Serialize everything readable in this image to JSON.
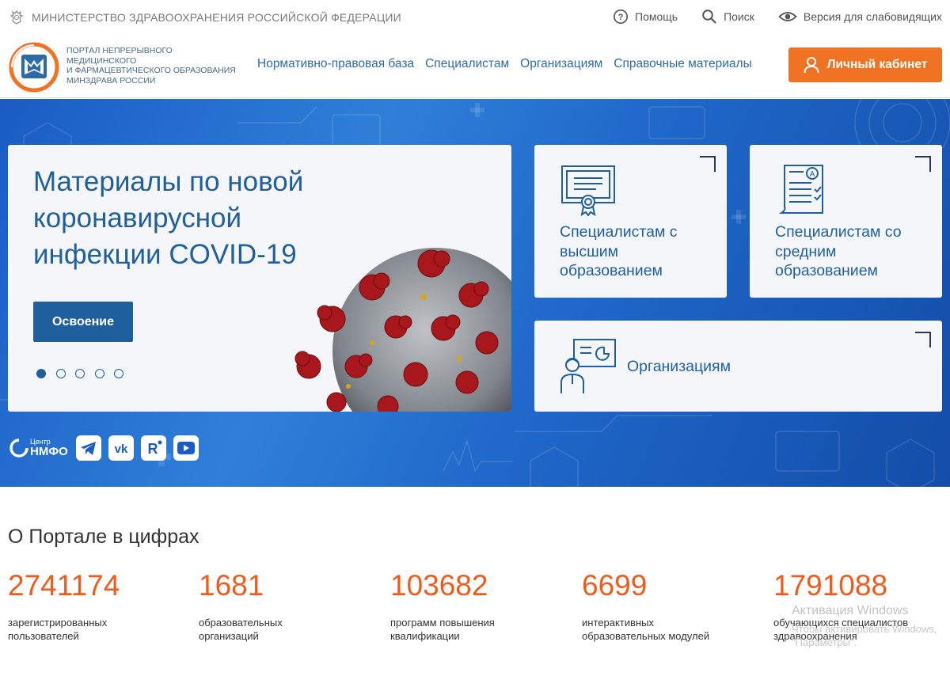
{
  "topbar": {
    "ministry": "МИНИСТЕРСТВО ЗДРАВООХРАНЕНИЯ РОССИЙСКОЙ ФЕДЕРАЦИИ",
    "help": "Помощь",
    "search": "Поиск",
    "accessibility": "Версия для слабовидящих"
  },
  "header": {
    "logo_lines": [
      "ПОРТАЛ НЕПРЕРЫВНОГО",
      "МЕДИЦИНСКОГО",
      "И ФАРМАЦЕВТИЧЕСКОГО ОБРАЗОВАНИЯ",
      "МИНЗДРАВА РОССИИ"
    ],
    "nav": [
      "Нормативно-правовая база",
      "Специалистам",
      "Организациям",
      "Справочные материалы"
    ],
    "cabinet": "Личный кабинет"
  },
  "hero": {
    "slide_title": "Материалы по новой коронавирусной инфекции COVID-19",
    "slide_button": "Освоение",
    "slides_count": 5,
    "active_slide": 1,
    "card_higher": "Специалистам с высшим образованием",
    "card_secondary": "Специалистам со средним образованием",
    "card_orgs": "Организациям",
    "nmfo_small": "Центр",
    "nmfo_big": "НМФО",
    "socials": [
      "telegram-icon",
      "vk-icon",
      "rutube-icon",
      "youtube-icon"
    ]
  },
  "stats": {
    "title": "О Портале в цифрах",
    "items": [
      {
        "value": "2741174",
        "label": "зарегистрированных пользователей"
      },
      {
        "value": "1681",
        "label": "образовательных организаций"
      },
      {
        "value": "103682",
        "label": "программ повышения квалификации"
      },
      {
        "value": "6699",
        "label": "интерактивных образовательных модулей"
      },
      {
        "value": "1791088",
        "label": "обучающихся специалистов здравоохранения"
      }
    ]
  },
  "watermark": {
    "title": "Активация Windows",
    "subtitle": "Чтобы активировать Windows, \"Параметры\"."
  },
  "colors": {
    "accent_orange": "#f07324",
    "stat_orange": "#f25a1c",
    "brand_blue": "#1f5f9e",
    "nav_blue": "#2d6ba6"
  }
}
